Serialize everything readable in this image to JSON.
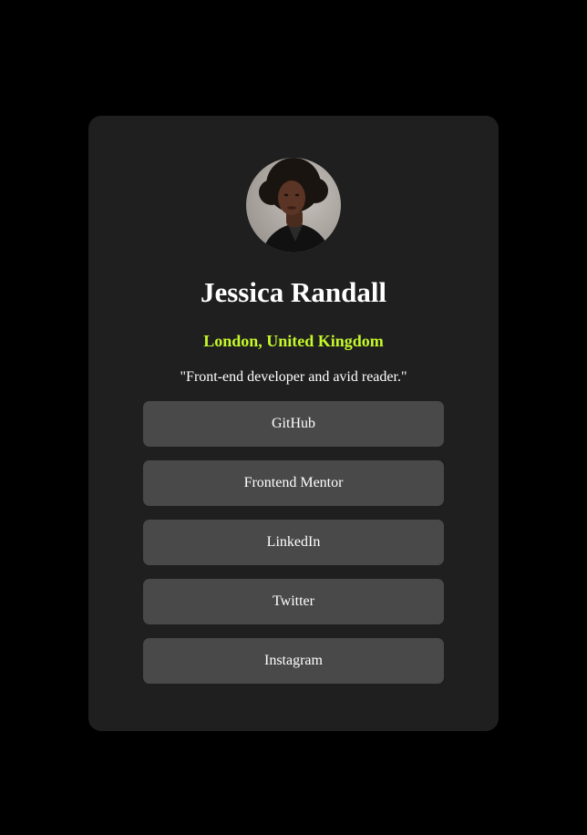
{
  "profile": {
    "name": "Jessica Randall",
    "location": "London, United Kingdom",
    "bio": "\"Front-end developer and avid reader.\""
  },
  "links": [
    {
      "label": "GitHub"
    },
    {
      "label": "Frontend Mentor"
    },
    {
      "label": "LinkedIn"
    },
    {
      "label": "Twitter"
    },
    {
      "label": "Instagram"
    }
  ],
  "colors": {
    "page_background": "#000000",
    "card_background": "#1f1f1f",
    "button_background": "#4a4949",
    "accent": "#c5f82a",
    "text": "#ffffff"
  }
}
